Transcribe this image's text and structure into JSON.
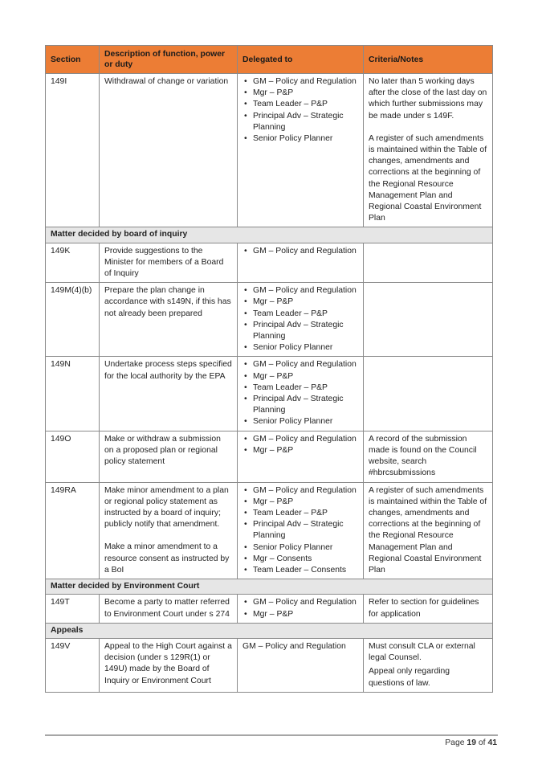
{
  "table": {
    "headers": [
      "Section",
      "Description of function, power or duty",
      "Delegated to",
      "Criteria/Notes"
    ],
    "rows": [
      {
        "type": "data",
        "section": "149I",
        "description": [
          "Withdrawal of change or variation"
        ],
        "delegated": [
          "GM – Policy and Regulation",
          "Mgr – P&P",
          "Team Leader – P&P",
          "Principal Adv – Strategic Planning",
          "Senior Policy Planner"
        ],
        "delegated_bullets": true,
        "notes": [
          "No later than 5 working days after the close of the last day on which further submissions may be made under s 149F.",
          "A register of such amendments is maintained within the Table of changes, amendments and corrections at the beginning of the Regional Resource Management Plan and Regional Coastal Environment Plan"
        ]
      },
      {
        "type": "group",
        "label": "Matter decided by board of inquiry"
      },
      {
        "type": "data",
        "section": "149K",
        "description": [
          "Provide suggestions to the Minister for members of a Board of Inquiry"
        ],
        "delegated": [
          "GM – Policy and Regulation"
        ],
        "delegated_bullets": true,
        "notes": []
      },
      {
        "type": "data",
        "section": "149M(4)(b)",
        "description": [
          "Prepare the plan change in accordance with s149N, if this has not already been prepared"
        ],
        "delegated": [
          "GM – Policy and Regulation",
          "Mgr – P&P",
          "Team Leader – P&P",
          "Principal Adv – Strategic Planning",
          "Senior Policy Planner"
        ],
        "delegated_bullets": true,
        "notes": []
      },
      {
        "type": "data",
        "section": "149N",
        "description": [
          "Undertake process steps specified for the local authority by the EPA"
        ],
        "delegated": [
          "GM – Policy and Regulation",
          "Mgr – P&P",
          "Team Leader – P&P",
          "Principal Adv – Strategic Planning",
          "Senior Policy Planner"
        ],
        "delegated_bullets": true,
        "notes": []
      },
      {
        "type": "data",
        "section": "149O",
        "description": [
          "Make or withdraw a submission on a proposed plan or regional policy statement"
        ],
        "delegated": [
          "GM – Policy and Regulation",
          "Mgr – P&P"
        ],
        "delegated_bullets": true,
        "notes": [
          "A record of the submission made is found on the Council website, search #hbrcsubmissions"
        ]
      },
      {
        "type": "data",
        "section": "149RA",
        "description": [
          "Make minor amendment to a plan or regional policy statement as instructed by a board of inquiry; publicly notify that amendment.",
          "Make a minor amendment to a resource consent as instructed by a BoI"
        ],
        "delegated": [
          "GM – Policy and Regulation",
          "Mgr – P&P",
          "Team Leader – P&P",
          "Principal Adv – Strategic Planning",
          "Senior Policy Planner",
          "Mgr – Consents",
          "Team Leader – Consents"
        ],
        "delegated_bullets": true,
        "notes": [
          "A register of such amendments is maintained within the Table of changes, amendments and corrections at the beginning of the Regional Resource Management Plan and Regional Coastal Environment Plan"
        ]
      },
      {
        "type": "group",
        "label": "Matter decided by Environment Court"
      },
      {
        "type": "data",
        "section": "149T",
        "description": [
          "Become a party to matter referred to Environment Court under s 274"
        ],
        "delegated": [
          "GM – Policy and Regulation",
          "Mgr – P&P"
        ],
        "delegated_bullets": true,
        "notes": [
          "Refer to section for guidelines for application"
        ]
      },
      {
        "type": "group",
        "label": "Appeals"
      },
      {
        "type": "data",
        "section": "149V",
        "description": [
          "Appeal to the High Court against a decision (under s 129R(1) or 149U) made by the Board of Inquiry or Environment Court"
        ],
        "delegated": [
          "GM – Policy and Regulation"
        ],
        "delegated_bullets": false,
        "notes": [
          "Must consult CLA or external legal Counsel.",
          "Appeal only regarding questions of law."
        ],
        "notes_tight": true
      }
    ]
  },
  "footer": {
    "page_prefix": "Page",
    "page_current": "19",
    "page_sep": "of",
    "page_total": "41"
  }
}
